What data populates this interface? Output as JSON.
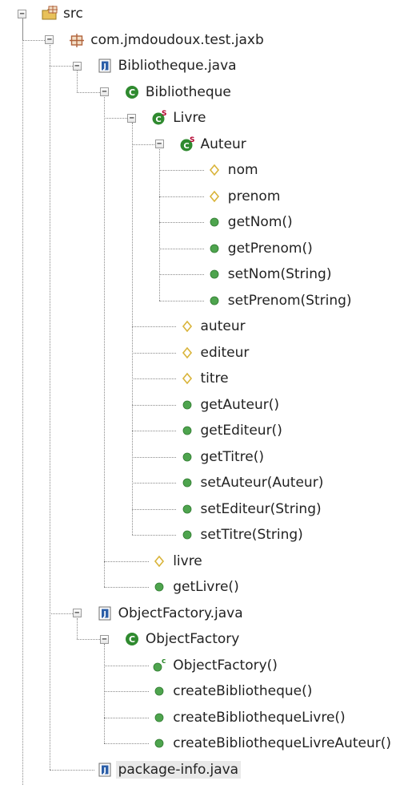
{
  "tree": {
    "nodes": [
      {
        "label": "src",
        "icon": "source-folder-icon",
        "level": 0,
        "toggle": "minus"
      },
      {
        "label": "com.jmdoudoux.test.jaxb",
        "icon": "package-icon",
        "level": 1,
        "toggle": "minus"
      },
      {
        "label": "Bibliotheque.java",
        "icon": "java-file-icon",
        "level": 2,
        "toggle": "minus"
      },
      {
        "label": "Bibliotheque",
        "icon": "class-icon",
        "level": 3,
        "toggle": "minus"
      },
      {
        "label": "Livre",
        "icon": "static-class-icon",
        "level": 4,
        "toggle": "minus"
      },
      {
        "label": "Auteur",
        "icon": "static-class-icon",
        "level": 5,
        "toggle": "minus"
      },
      {
        "label": "nom",
        "icon": "field-icon",
        "level": 6
      },
      {
        "label": "prenom",
        "icon": "field-icon",
        "level": 6
      },
      {
        "label": "getNom()",
        "icon": "method-icon",
        "level": 6
      },
      {
        "label": "getPrenom()",
        "icon": "method-icon",
        "level": 6
      },
      {
        "label": "setNom(String)",
        "icon": "method-icon",
        "level": 6
      },
      {
        "label": "setPrenom(String)",
        "icon": "method-icon",
        "level": 6
      },
      {
        "label": "auteur",
        "icon": "field-icon",
        "level": 5
      },
      {
        "label": "editeur",
        "icon": "field-icon",
        "level": 5
      },
      {
        "label": "titre",
        "icon": "field-icon",
        "level": 5
      },
      {
        "label": "getAuteur()",
        "icon": "method-icon",
        "level": 5
      },
      {
        "label": "getEditeur()",
        "icon": "method-icon",
        "level": 5
      },
      {
        "label": "getTitre()",
        "icon": "method-icon",
        "level": 5
      },
      {
        "label": "setAuteur(Auteur)",
        "icon": "method-icon",
        "level": 5
      },
      {
        "label": "setEditeur(String)",
        "icon": "method-icon",
        "level": 5
      },
      {
        "label": "setTitre(String)",
        "icon": "method-icon",
        "level": 5
      },
      {
        "label": "livre",
        "icon": "field-icon",
        "level": 4
      },
      {
        "label": "getLivre()",
        "icon": "method-icon",
        "level": 4
      },
      {
        "label": "ObjectFactory.java",
        "icon": "java-file-icon",
        "level": 2,
        "toggle": "minus"
      },
      {
        "label": "ObjectFactory",
        "icon": "class-icon",
        "level": 3,
        "toggle": "minus"
      },
      {
        "label": "ObjectFactory()",
        "icon": "constructor-icon",
        "level": 4
      },
      {
        "label": "createBibliotheque()",
        "icon": "method-icon",
        "level": 4
      },
      {
        "label": "createBibliothequeLivre()",
        "icon": "method-icon",
        "level": 4
      },
      {
        "label": "createBibliothequeLivreAuteur()",
        "icon": "method-icon",
        "level": 4
      },
      {
        "label": "package-info.java",
        "icon": "java-file-icon",
        "level": 2,
        "selected": true
      }
    ]
  },
  "colors": {
    "method": "#4ea44e",
    "field": "#d9b43a",
    "class": "#2f8a2f",
    "static_marker": "#b3002d",
    "constructor_marker": "#2f8a2f",
    "java_file": "#2c5fa8",
    "package": "#b0623a",
    "folder": "#e8c15a"
  },
  "icons": {
    "class": "C",
    "static_marker": "S",
    "constructor_marker": "c",
    "java_file": "J",
    "minus": "−"
  }
}
